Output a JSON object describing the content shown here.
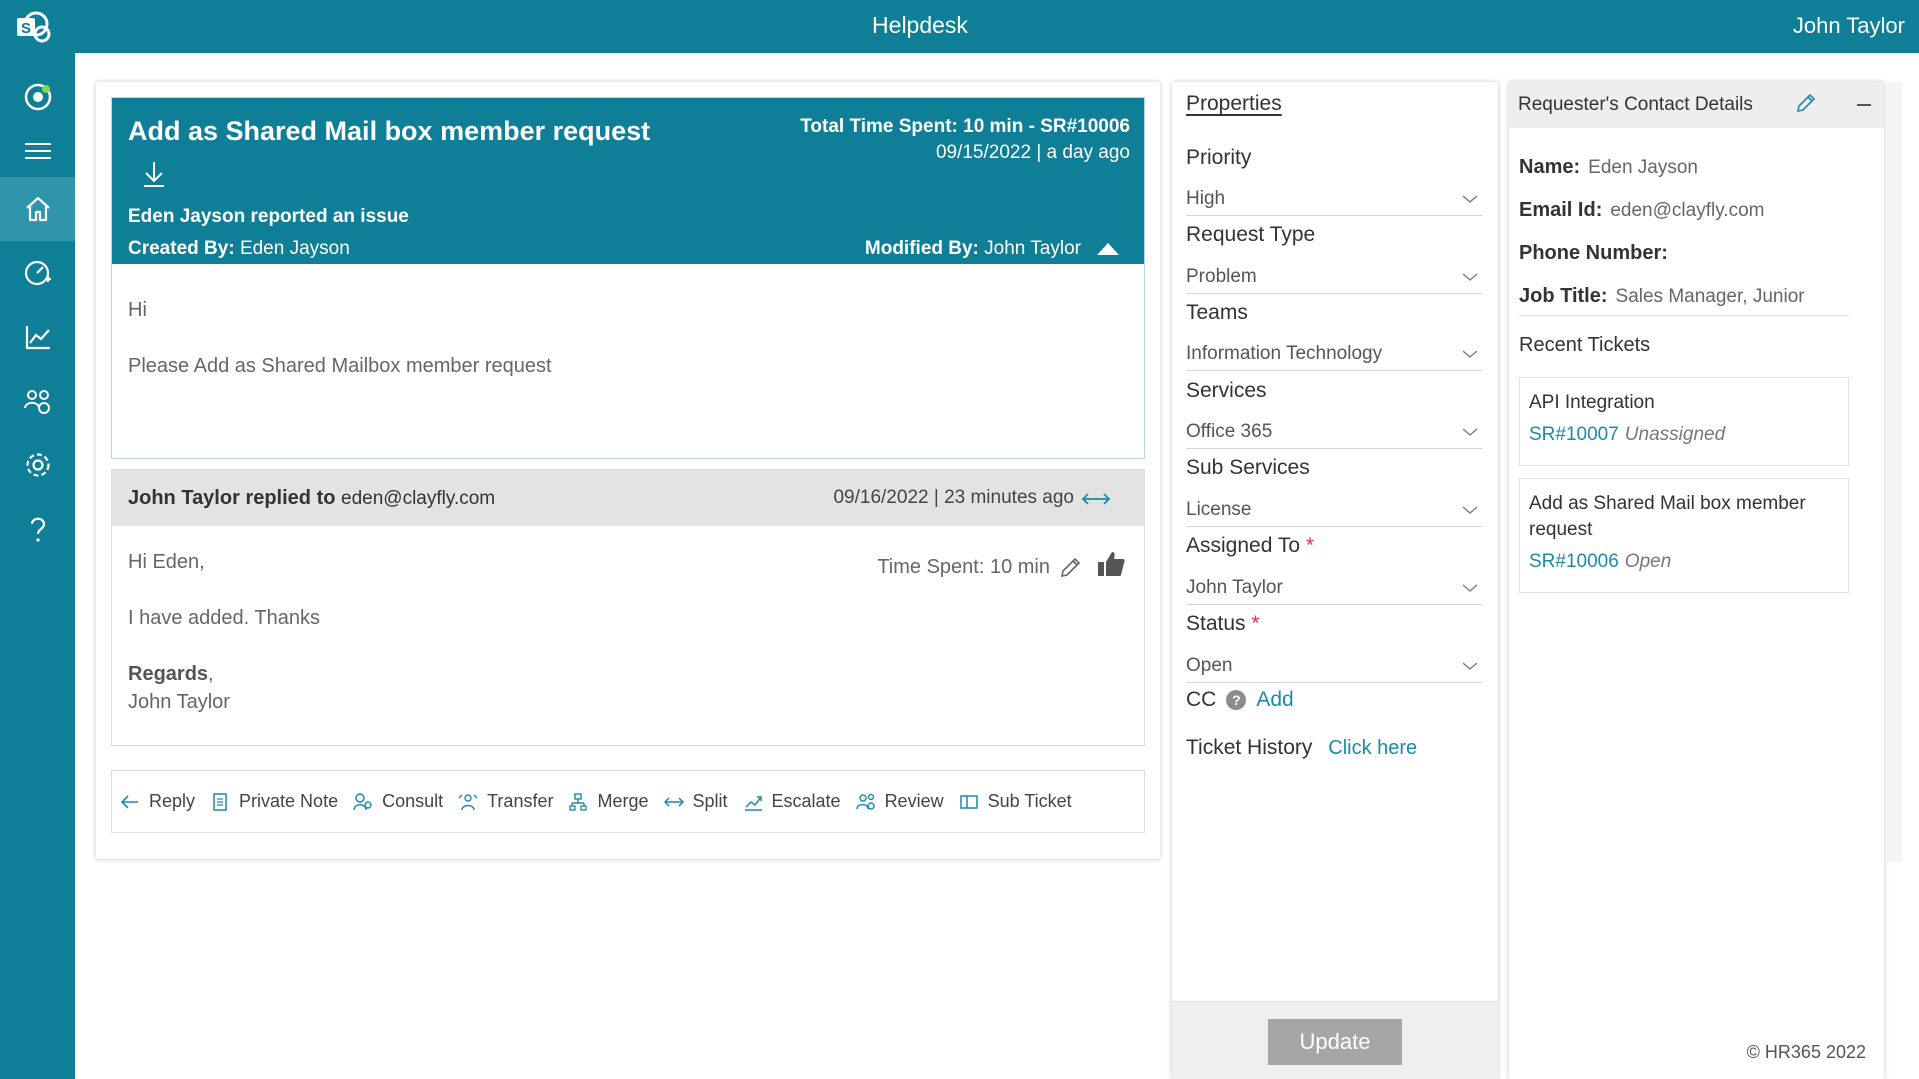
{
  "topbar": {
    "title": "Helpdesk",
    "user": "John Taylor"
  },
  "sidebar": {
    "items": [
      {
        "name": "dashboard-icon"
      },
      {
        "name": "menu-icon"
      },
      {
        "name": "home-icon",
        "active": true
      },
      {
        "name": "speedometer-icon"
      },
      {
        "name": "chart-icon"
      },
      {
        "name": "users-icon"
      },
      {
        "name": "settings-icon"
      },
      {
        "name": "help-icon"
      }
    ]
  },
  "ticket": {
    "title": "Add as Shared Mail box member request",
    "reported": "Eden Jayson reported an issue",
    "created_by_label": "Created By:",
    "created_by": "Eden Jayson",
    "total_time": "Total Time Spent: 10 min - SR#10006",
    "date": "09/15/2022 | a day ago",
    "modified_by_label": "Modified By:",
    "modified_by": "John Taylor",
    "body": [
      "Hi",
      "Please Add as Shared Mailbox member request"
    ]
  },
  "reply": {
    "author": "John Taylor",
    "verb": "replied to",
    "email": "eden@clayfly.com",
    "date": "09/16/2022 | 23 minutes ago",
    "time_spent": "Time Spent: 10 min",
    "greeting": "Hi Eden,",
    "message": "I have added. Thanks",
    "regards": "Regards",
    "regards_comma": ",",
    "signature": "John Taylor"
  },
  "actions": [
    {
      "label": "Reply",
      "icon": "reply-icon"
    },
    {
      "label": "Private Note",
      "icon": "note-icon"
    },
    {
      "label": "Consult",
      "icon": "consult-icon"
    },
    {
      "label": "Transfer",
      "icon": "transfer-icon"
    },
    {
      "label": "Merge",
      "icon": "merge-icon"
    },
    {
      "label": "Split",
      "icon": "split-icon"
    },
    {
      "label": "Escalate",
      "icon": "escalate-icon"
    },
    {
      "label": "Review",
      "icon": "review-icon"
    },
    {
      "label": "Sub Ticket",
      "icon": "sub-ticket-icon"
    }
  ],
  "properties": {
    "title": "Properties",
    "priority_label": "Priority",
    "priority": "High",
    "request_type_label": "Request Type",
    "request_type": "Problem",
    "teams_label": "Teams",
    "teams": "Information Technology",
    "services_label": "Services",
    "services": "Office 365",
    "sub_services_label": "Sub Services",
    "sub_services": "License",
    "assigned_label": "Assigned To",
    "assigned": "John Taylor",
    "status_label": "Status",
    "status": "Open",
    "required_mark": "*",
    "cc_label": "CC",
    "cc_help": "?",
    "cc_add": "Add",
    "history_label": "Ticket History",
    "history_link": "Click here",
    "update": "Update"
  },
  "contact": {
    "title": "Requester's Contact Details",
    "name_label": "Name:",
    "name": "Eden Jayson",
    "email_label": "Email Id:",
    "email": "eden@clayfly.com",
    "phone_label": "Phone Number:",
    "phone": "",
    "job_label": "Job Title:",
    "job": "Sales Manager, Junior",
    "recent_label": "Recent Tickets",
    "recent": [
      {
        "title": "API Integration",
        "id": "SR#10007",
        "status": "Unassigned"
      },
      {
        "title": "Add as Shared Mail box member request",
        "id": "SR#10006",
        "status": "Open"
      }
    ],
    "copyright": "© HR365 2022"
  },
  "colors": {
    "brand": "#0f7f97",
    "link": "#1a8ca8",
    "required": "#d9304f"
  }
}
